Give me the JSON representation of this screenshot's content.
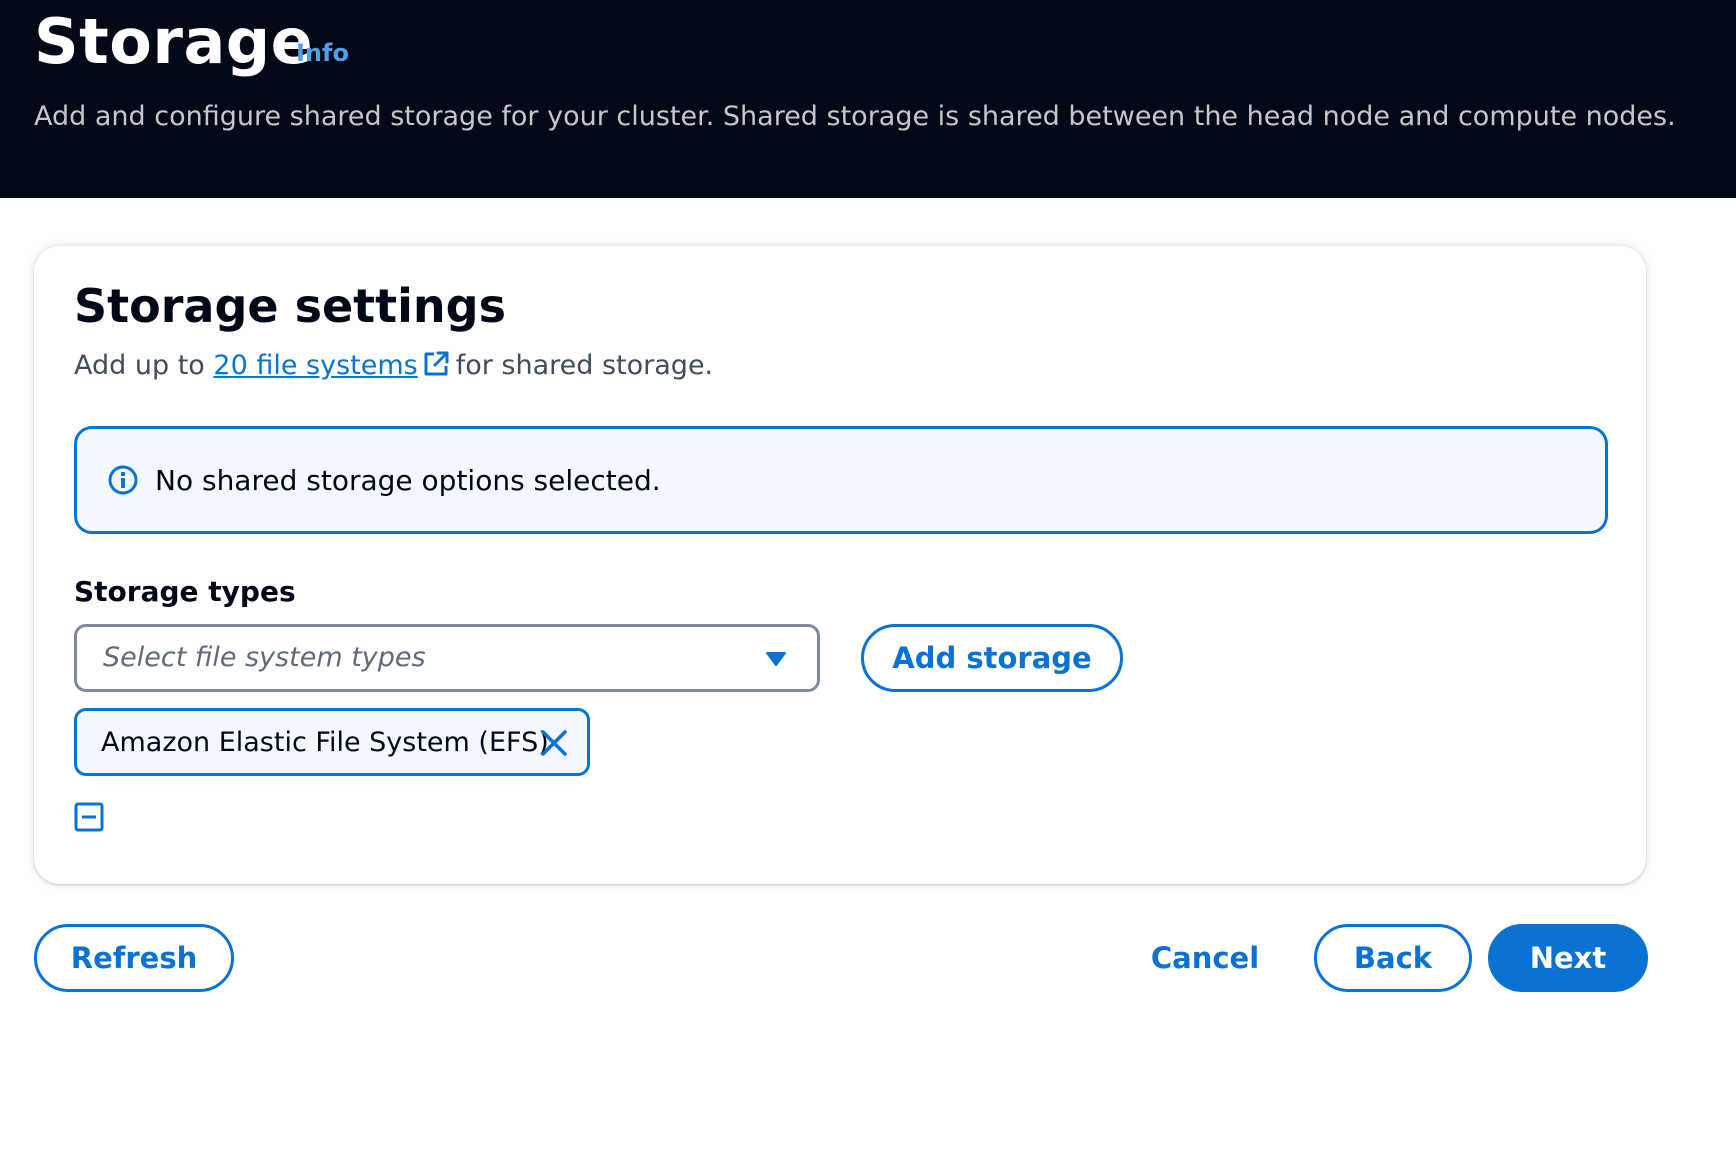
{
  "header": {
    "title": "Storage",
    "info_label": "Info",
    "description": "Add and configure shared storage for your cluster. Shared storage is shared between the head node and compute nodes."
  },
  "card": {
    "title": "Storage settings",
    "desc_prefix": "Add up to ",
    "desc_link": "20 file systems",
    "desc_suffix": "for shared storage.",
    "alert_text": "No shared storage options selected.",
    "storage_types_label": "Storage types",
    "select_placeholder": "Select file system types",
    "add_storage_label": "Add storage",
    "token_label": "Amazon Elastic File System (EFS)"
  },
  "footer": {
    "refresh_label": "Refresh",
    "cancel_label": "Cancel",
    "back_label": "Back",
    "next_label": "Next"
  },
  "icons": {
    "info": "info-circle-icon",
    "external": "external-link-icon",
    "caret": "caret-down-icon",
    "close": "close-icon",
    "collapse": "minus-square-icon"
  },
  "colors": {
    "header_bg": "#020916",
    "accent": "#0972d3",
    "alert_bg": "#f2f8fd",
    "info_link": "#539fe5"
  }
}
